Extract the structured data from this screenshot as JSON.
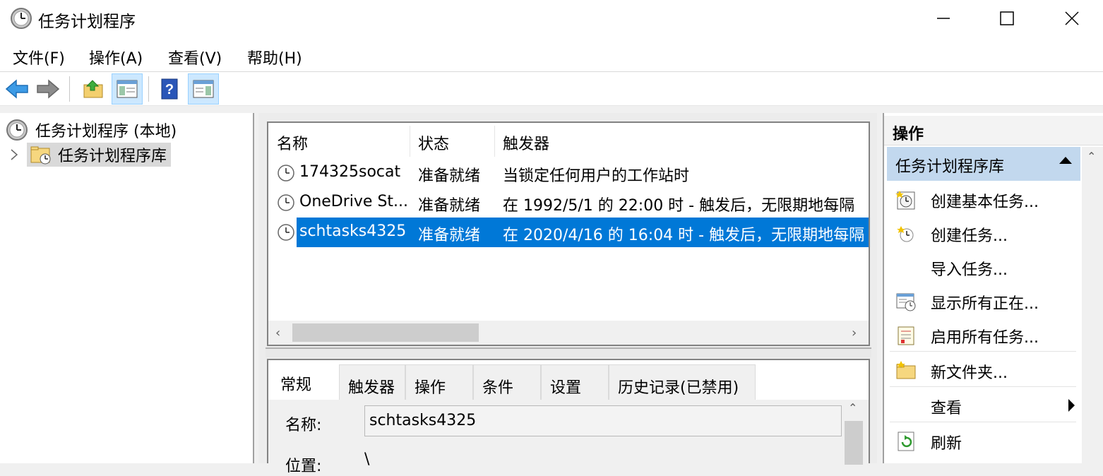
{
  "window": {
    "title": "任务计划程序",
    "controls": {
      "minimize": "minimize",
      "maximize": "maximize",
      "close": "close"
    }
  },
  "menu": [
    "文件(F)",
    "操作(A)",
    "查看(V)",
    "帮助(H)"
  ],
  "toolbar": {
    "icons": [
      "back-arrow-icon",
      "forward-arrow-icon",
      "up-folder-icon",
      "show-hide-console-tree-icon",
      "help-icon",
      "show-hide-action-pane-icon"
    ]
  },
  "tree": {
    "root": "任务计划程序 (本地)",
    "child": "任务计划程序库"
  },
  "task_list": {
    "columns": [
      "名称",
      "状态",
      "触发器"
    ],
    "rows": [
      {
        "name": "174325socat",
        "status": "准备就绪",
        "trigger": "当锁定任何用户的工作站时"
      },
      {
        "name": "OneDrive St...",
        "status": "准备就绪",
        "trigger": "在 1992/5/1 的 22:00 时 - 触发后，无限期地每隔"
      },
      {
        "name": "schtasks4325",
        "status": "准备就绪",
        "trigger": "在 2020/4/16 的 16:04 时 - 触发后，无限期地每隔"
      }
    ],
    "selected_index": 2
  },
  "detail": {
    "tabs": [
      "常规",
      "触发器",
      "操作",
      "条件",
      "设置",
      "历史记录(已禁用)"
    ],
    "active_tab": 0,
    "name_label": "名称:",
    "name_value": "schtasks4325",
    "location_label": "位置:",
    "location_value": "\\"
  },
  "actions": {
    "header": "操作",
    "section": "任务计划程序库",
    "items": [
      {
        "label": "创建基本任务...",
        "icon": "create-basic-task-icon"
      },
      {
        "label": "创建任务...",
        "icon": "create-task-icon"
      },
      {
        "label": "导入任务...",
        "icon": ""
      },
      {
        "label": "显示所有正在...",
        "icon": "display-running-tasks-icon"
      },
      {
        "label": "启用所有任务...",
        "icon": "enable-history-icon"
      },
      {
        "label": "新文件夹...",
        "icon": "new-folder-icon"
      },
      {
        "label": "查看",
        "icon": ""
      },
      {
        "label": "刷新",
        "icon": "refresh-icon"
      }
    ]
  },
  "colors": {
    "selection": "#0078d7",
    "section_bg": "#c2d8ee",
    "toolbar_active": "#cce8ff"
  }
}
